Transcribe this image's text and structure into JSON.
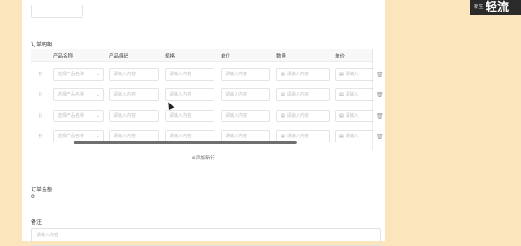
{
  "form": {
    "section_title": "订单明细",
    "columns": [
      "产品名称",
      "产品编码",
      "规格",
      "单位",
      "数量",
      "单价"
    ],
    "rows": [
      {
        "product_name": "选择产品名称",
        "product_code": "请输入内容",
        "spec": "请输入内容",
        "unit": "请输入内容",
        "qty": "请输入内容",
        "price": "请输入"
      },
      {
        "product_name": "选择产品名称",
        "product_code": "请输入内容",
        "spec": "请输入内容",
        "unit": "请输入内容",
        "qty": "请输入内容",
        "price": "请输入"
      },
      {
        "product_name": "选择产品名称",
        "product_code": "请输入内容",
        "spec": "请输入内容",
        "unit": "请输入内容",
        "qty": "请输入内容",
        "price": "请输入"
      },
      {
        "product_name": "选择产品名称",
        "product_code": "请输入内容",
        "spec": "请输入内容",
        "unit": "请输入内容",
        "qty": "请输入内容",
        "price": "请输入"
      }
    ],
    "add_row_label": "⊕添加新行",
    "total_label": "订单金额",
    "total_value": "0",
    "remark_label": "备注",
    "remark_placeholder": "请输入内容"
  },
  "icons": {
    "drag": "drag-handle-icon",
    "select": "chevron-down-icon",
    "number": "number-icon",
    "delete": "trash-icon"
  },
  "watermark": {
    "small_text": "新生",
    "text": "轻流"
  },
  "colors": {
    "background": "#fbe5bd",
    "panel": "#ffffff",
    "scrollbar": "#6f6f6f"
  }
}
